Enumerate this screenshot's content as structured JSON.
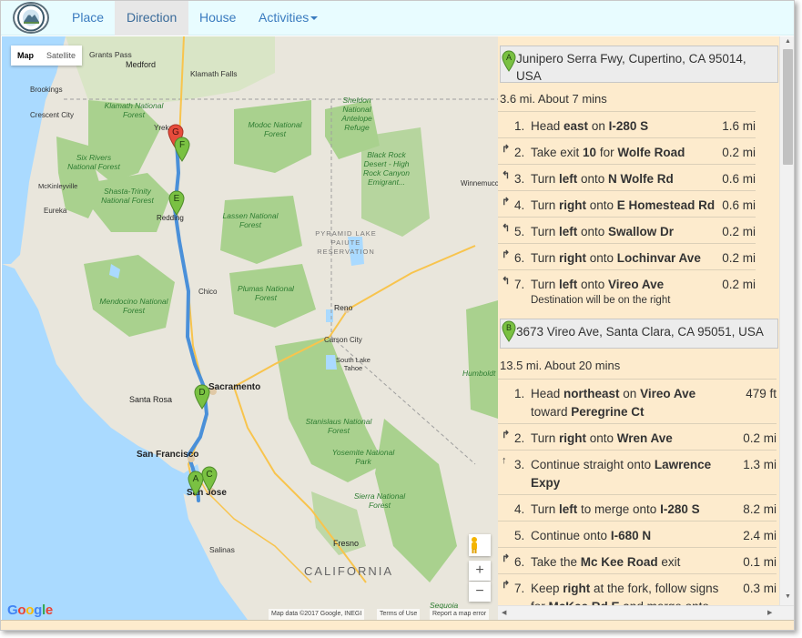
{
  "nav": {
    "logo_icon": "mountain-seal-icon",
    "place": "Place",
    "direction": "Direction",
    "house": "House",
    "activities": "Activities"
  },
  "map": {
    "type_map": "Map",
    "type_satellite": "Satellite",
    "zoom_in": "+",
    "zoom_out": "−",
    "pegman_icon": "pegman-icon",
    "google": "Google",
    "attribution": "Map data ©2017 Google, INEGI",
    "terms": "Terms of Use",
    "report": "Report a map error",
    "labels": {
      "grants_pass": "Grants Pass",
      "medford": "Medford",
      "klamath_falls": "Klamath Falls",
      "brookings": "Brookings",
      "crescent_city": "Crescent City",
      "klamath_nf": "Klamath National Forest",
      "sheldon": "Sheldon National Antelope Refuge",
      "modoc": "Modoc National Forest",
      "yreka": "Yreka",
      "black_rock": "Black Rock Desert - High Rock Canyon Emigrant...",
      "winnemucca": "Winnemucca",
      "six_rivers": "Six Rivers National Forest",
      "mckinleyville": "McKinleyville",
      "shasta": "Shasta-Trinity National Forest",
      "eureka": "Eureka",
      "redding": "Redding",
      "lassen": "Lassen National Forest",
      "pyramid": "PYRAMID LAKE PAIUTE RESERVATION",
      "chico": "Chico",
      "mendocino": "Mendocino National Forest",
      "plumas": "Plumas National Forest",
      "reno": "Reno",
      "carson": "Carson City",
      "south_tahoe": "South Lake Tahoe",
      "humboldt": "Humboldt",
      "sacramento": "Sacramento",
      "santa_rosa": "Santa Rosa",
      "stanislaus": "Stanislaus National Forest",
      "san_francisco": "San Francisco",
      "yosemite": "Yosemite National Park",
      "san_jose": "San Jose",
      "sierra": "Sierra National Forest",
      "salinas": "Salinas",
      "fresno": "Fresno",
      "california": "CALIFORNIA",
      "sequoia": "Sequoia"
    },
    "markers": [
      "A",
      "C",
      "D",
      "E",
      "F",
      "G"
    ]
  },
  "directions": {
    "leg1": {
      "marker": "A",
      "address": "Junipero Serra Fwy, Cupertino, CA 95014, USA",
      "summary": "3.6 mi. About 7 mins",
      "steps": [
        {
          "num": "1.",
          "icon": "",
          "html": "Head <b>east</b> on <b>I-280 S</b>",
          "dist": "1.6 mi"
        },
        {
          "num": "2.",
          "icon": "ramp-right-icon",
          "html": "Take exit <b>10</b> for <b>Wolfe Road</b>",
          "dist": "0.2 mi"
        },
        {
          "num": "3.",
          "icon": "turn-left-icon",
          "html": "Turn <b>left</b> onto <b>N Wolfe Rd</b>",
          "dist": "0.6 mi"
        },
        {
          "num": "4.",
          "icon": "turn-right-icon",
          "html": "Turn <b>right</b> onto <b>E Homestead Rd</b>",
          "dist": "0.6 mi"
        },
        {
          "num": "5.",
          "icon": "turn-left-icon",
          "html": "Turn <b>left</b> onto <b>Swallow Dr</b>",
          "dist": "0.2 mi"
        },
        {
          "num": "6.",
          "icon": "turn-right-icon",
          "html": "Turn <b>right</b> onto <b>Lochinvar Ave</b>",
          "dist": "0.2 mi"
        },
        {
          "num": "7.",
          "icon": "turn-left-icon",
          "html": "Turn <b>left</b> onto <b>Vireo Ave</b>",
          "note": "Destination will be on the right",
          "dist": "0.2 mi"
        }
      ]
    },
    "leg2": {
      "marker": "B",
      "address": "3673 Vireo Ave, Santa Clara, CA 95051, USA",
      "summary": "13.5 mi. About 20 mins",
      "steps": [
        {
          "num": "1.",
          "icon": "",
          "html": "Head <b>northeast</b> on <b>Vireo Ave</b><br>toward <b>Peregrine Ct</b>",
          "dist": "479 ft"
        },
        {
          "num": "2.",
          "icon": "turn-right-icon",
          "html": "Turn <b>right</b> onto <b>Wren Ave</b>",
          "dist": "0.2 mi"
        },
        {
          "num": "3.",
          "icon": "straight-icon",
          "html": "Continue straight onto <b>Lawrence</b><br><b>Expy</b>",
          "dist": "1.3 mi"
        },
        {
          "num": "4.",
          "icon": "",
          "html": "Turn <b>left</b> to merge onto <b>I-280 S</b>",
          "dist": "8.2 mi"
        },
        {
          "num": "5.",
          "icon": "",
          "html": "Continue onto <b>I-680 N</b>",
          "dist": "2.4 mi"
        },
        {
          "num": "6.",
          "icon": "ramp-right-icon",
          "html": "Take the <b>Mc Kee Road</b> exit",
          "dist": "0.1 mi"
        },
        {
          "num": "7.",
          "icon": "fork-right-icon",
          "html": "Keep <b>right</b> at the fork, follow signs<br>for <b>McKee Rd E</b> and merge onto",
          "dist": "0.3 mi"
        }
      ]
    }
  },
  "colors": {
    "navbar": "#e8fcff",
    "panel": "#fdebcd",
    "route": "#4a90d9",
    "marker_green": "#6db33f",
    "marker_red": "#d9534f",
    "link": "#3a7bbf"
  }
}
